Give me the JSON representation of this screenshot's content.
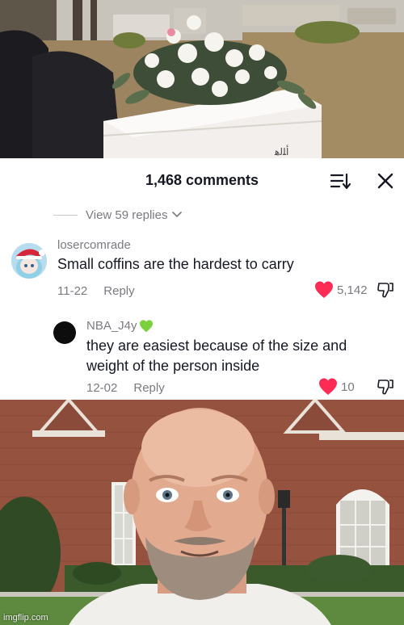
{
  "header": {
    "comment_count": "1,468 comments"
  },
  "thread": {
    "view_replies": "View 59 replies"
  },
  "comments": [
    {
      "username": "losercomrade",
      "text": "Small coffins are the hardest to carry",
      "date": "11-22",
      "reply_label": "Reply",
      "likes": "5,142"
    },
    {
      "username": "NBA_J4y",
      "username_badge": "green-heart-icon",
      "text_line1": "they are easiest because of the size and",
      "text_line2": "weight of the person inside",
      "date": "12-02",
      "reply_label": "Reply",
      "likes": "10"
    }
  ],
  "watermark": "imgflip.com",
  "colors": {
    "like_red": "#fe2c55",
    "meta_gray": "#7a7b80",
    "text_dark": "#161823",
    "badge_green": "#7bd03e"
  }
}
